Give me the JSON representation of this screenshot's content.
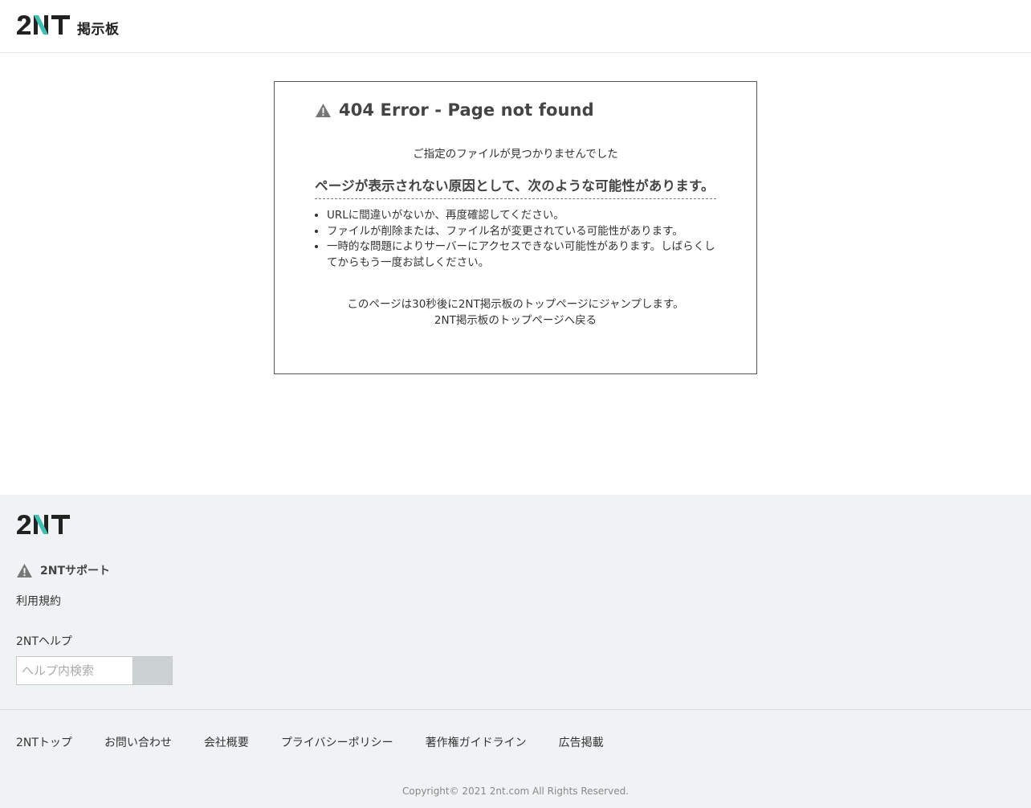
{
  "header": {
    "logo_text": "2NT",
    "logo_sub": "掲示板"
  },
  "error": {
    "title": "404 Error - Page not found",
    "message": "ご指定のファイルが見つかりませんでした",
    "causes_heading": "ページが表示されない原因として、次のような可能性があります。",
    "causes": [
      "URLに間違いがないか、再度確認してください。",
      "ファイルが削除または、ファイル名が変更されている可能性があります。",
      "一時的な問題によりサーバーにアクセスできない可能性があります。しばらくしてからもう一度お試しください。"
    ],
    "redirect_text": "このページは30秒後に2NT掲示板のトップページにジャンプします。",
    "back_link": "2NT掲示板のトップページへ戻る"
  },
  "footer": {
    "logo_text": "2NT",
    "support_heading": "2NTサポート",
    "terms_link": "利用規約",
    "help_label": "2NTヘルプ",
    "help_search_placeholder": "ヘルプ内検索",
    "nav": [
      "2NTトップ",
      "お問い合わせ",
      "会社概要",
      "プライバシーポリシー",
      "著作権ガイドライン",
      "広告掲載"
    ],
    "copyright": "Copyright© 2021 2nt.com All Rights Reserved."
  },
  "colors": {
    "brand_dark": "#222222",
    "brand_accent": "#3ec1b0",
    "footer_bg": "#eff3f4",
    "warning_icon": "#777777"
  },
  "icons": [
    "logo-2nt",
    "warning-icon"
  ]
}
